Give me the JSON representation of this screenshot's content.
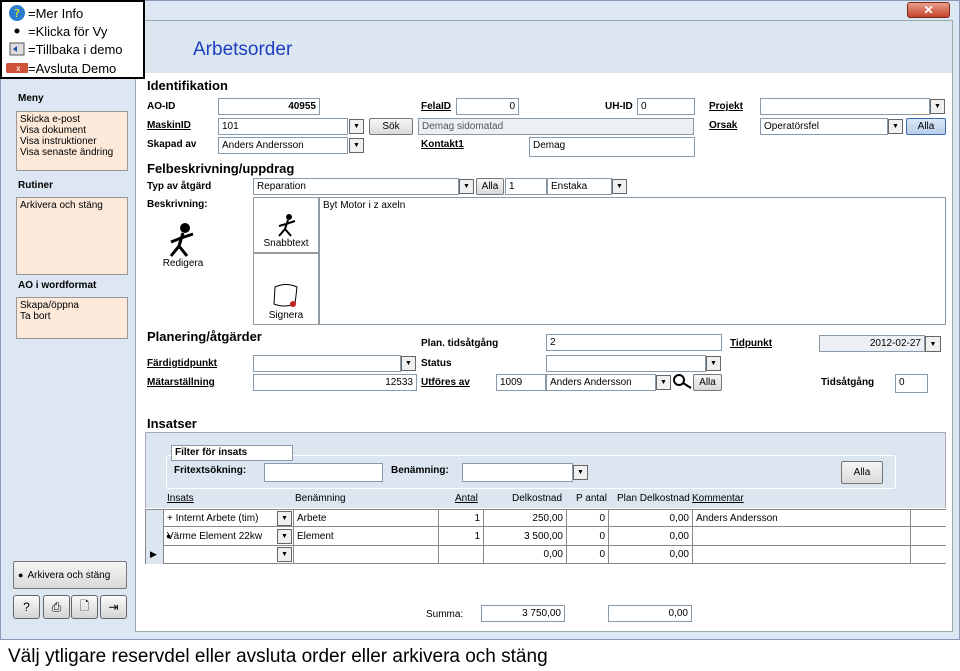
{
  "legend": {
    "items": [
      {
        "icon": "info-icon",
        "label": "=Mer Info"
      },
      {
        "icon": "bullet-icon",
        "label": "=Klicka för Vy"
      },
      {
        "icon": "back-icon",
        "label": "=Tillbaka i demo"
      },
      {
        "icon": "close-icon",
        "label": "=Avsluta Demo"
      }
    ]
  },
  "window": {
    "close_label": "✕"
  },
  "header": {
    "title": "Arbetsorder"
  },
  "sidebar": {
    "meny_title": "Meny",
    "meny_items": [
      "Skicka e-post",
      "Visa dokument",
      "Visa instruktioner",
      "Visa senaste ändring"
    ],
    "rutiner_title": "Rutiner",
    "rutiner_items": [
      "Arkivera och stäng"
    ],
    "ao_title": "AO i wordformat",
    "ao_items": [
      "Skapa/öppna",
      "Ta bort"
    ],
    "archive_button": "Arkivera och stäng"
  },
  "identifikation": {
    "title": "Identifikation",
    "ao_id_label": "AO-ID",
    "ao_id": "40955",
    "maskin_label": "MaskinID",
    "maskin": "101",
    "sok_button": "Sök",
    "maskin_desc": "Demag sidomatad",
    "skapad_label": "Skapad av",
    "skapad": "Anders Andersson",
    "felaid_label": "FelaID",
    "felaid": "0",
    "uhid_label": "UH-ID",
    "uhid": "0",
    "kontakt_label": "Kontakt1",
    "kontakt": "Demag",
    "projekt_label": "Projekt",
    "projekt": "",
    "orsak_label": "Orsak",
    "orsak": "Operatörsfel",
    "alla_button": "Alla"
  },
  "felbeskrivning": {
    "title": "Felbeskrivning/uppdrag",
    "typ_label": "Typ av åtgärd",
    "typ": "Reparation",
    "alla_button": "Alla",
    "antal": "1",
    "enstaka": "Enstaka",
    "beskrivning_label": "Beskrivning:",
    "redigera": "Redigera",
    "snabbtext": "Snabbtext",
    "signera": "Signera",
    "text": "Byt Motor i z axeln"
  },
  "planering": {
    "title": "Planering/åtgärder",
    "fardig_label": "Färdigtidpunkt",
    "fardig": "",
    "matar_label": "Mätarställning",
    "matar": "12533",
    "plan_label": "Plan. tidsåtgång",
    "plan": "2",
    "status_label": "Status",
    "status": "",
    "utfores_label": "Utföres av",
    "utfores_id": "1009",
    "utfores_name": "Anders Andersson",
    "alla_button": "Alla",
    "tidpunkt_label": "Tidpunkt",
    "tidpunkt": "2012-02-27",
    "tidsatgang_label": "Tidsåtgång",
    "tidsatgang": "0"
  },
  "insatser": {
    "title": "Insatser",
    "filter_title": "Filter för insats",
    "fritext_label": "Fritextsökning:",
    "fritext": "",
    "benamning_label": "Benämning:",
    "benamning": "",
    "alla_button": "Alla",
    "columns": [
      "Insats",
      "Benämning",
      "Antal",
      "Delkostnad",
      "P antal",
      "Plan Delkostnad",
      "Kommentar"
    ],
    "rows": [
      {
        "insats": "+ Internt Arbete (tim)",
        "benamning": "Arbete",
        "antal": "1",
        "delkostnad": "250,00",
        "pantal": "0",
        "plan": "0,00",
        "kommentar": "Anders Andersson"
      },
      {
        "insats": "Värme Element 22kw",
        "benamning": "Element",
        "antal": "1",
        "delkostnad": "3 500,00",
        "pantal": "0",
        "plan": "0,00",
        "kommentar": ""
      },
      {
        "insats": "",
        "benamning": "",
        "antal": "",
        "delkostnad": "0,00",
        "pantal": "0",
        "plan": "0,00",
        "kommentar": ""
      }
    ],
    "summa_label": "Summa:",
    "summa": "3 750,00",
    "summa_plan": "0,00"
  },
  "caption": "Välj ytligare reservdel eller avsluta order eller arkivera och stäng",
  "colors": {
    "accent": "#1a3fbf",
    "side_box": "#fde9d9",
    "panel": "#dce6f1"
  }
}
